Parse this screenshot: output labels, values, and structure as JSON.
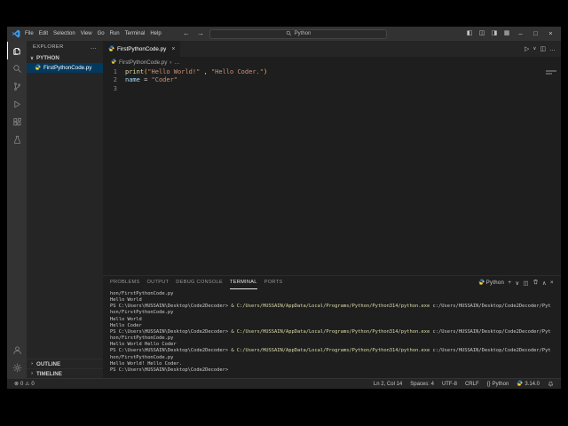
{
  "titlebar": {
    "menus": [
      "File",
      "Edit",
      "Selection",
      "View",
      "Go",
      "Run",
      "Terminal",
      "Help"
    ],
    "search_text": "Python",
    "nav": {
      "back": "←",
      "forward": "→"
    },
    "layout_icons": {
      "toggle_sidebar": "◧",
      "toggle_panel": "◫",
      "toggle_secondary": "◨",
      "customize": "▦"
    },
    "window_icons": {
      "minimize": "–",
      "maximize": "□",
      "close": "×"
    }
  },
  "activitybar": {
    "items": [
      {
        "name": "explorer-icon",
        "active": true
      },
      {
        "name": "search-icon",
        "active": false
      },
      {
        "name": "source-control-icon",
        "active": false
      },
      {
        "name": "run-debug-icon",
        "active": false
      },
      {
        "name": "extensions-icon",
        "active": false
      },
      {
        "name": "testing-icon",
        "active": false
      }
    ],
    "bottom": [
      {
        "name": "account-icon"
      },
      {
        "name": "settings-gear-icon"
      }
    ]
  },
  "sidebar": {
    "title": "EXPLORER",
    "more": "…",
    "folder": {
      "chevron": "∨",
      "label": "PYTHON"
    },
    "file": {
      "label": "FirstPythonCode.py"
    },
    "outline": {
      "chevron": "›",
      "label": "OUTLINE"
    },
    "timeline": {
      "chevron": "›",
      "label": "TIMELINE"
    }
  },
  "editor": {
    "tab": {
      "label": "FirstPythonCode.py",
      "close": "×"
    },
    "tab_actions": {
      "run": "▷",
      "dropdown": "∨",
      "split": "◫",
      "more": "…"
    },
    "breadcrumb": {
      "file": "FirstPythonCode.py",
      "chevron": "›",
      "more": "…"
    },
    "lines": [
      {
        "num": "1",
        "tokens": [
          {
            "t": "print",
            "c": "#dcdcaa"
          },
          {
            "t": "(",
            "c": "#ffd700"
          },
          {
            "t": "\"Hello World!\"",
            "c": "#ce9178"
          },
          {
            "t": " , ",
            "c": "#d4d4d4"
          },
          {
            "t": "\"Hello Coder.\"",
            "c": "#ce9178"
          },
          {
            "t": ")",
            "c": "#ffd700"
          }
        ]
      },
      {
        "num": "2",
        "tokens": [
          {
            "t": "name",
            "c": "#9cdcfe"
          },
          {
            "t": " = ",
            "c": "#d4d4d4"
          },
          {
            "t": "\"Coder\"",
            "c": "#ce9178"
          }
        ]
      },
      {
        "num": "3",
        "tokens": []
      }
    ]
  },
  "panel": {
    "tabs": [
      {
        "label": "PROBLEMS",
        "active": false
      },
      {
        "label": "OUTPUT",
        "active": false
      },
      {
        "label": "DEBUG CONSOLE",
        "active": false
      },
      {
        "label": "TERMINAL",
        "active": true
      },
      {
        "label": "PORTS",
        "active": false
      }
    ],
    "actions": {
      "profile": "Python",
      "plus": "+",
      "dropdown": "∨",
      "split": "◫",
      "chevron_up": "∧",
      "close": "×"
    },
    "terminal_lines": [
      {
        "segs": [
          {
            "t": "hon/FirstPythonCode.py",
            "c": "#cccccc"
          }
        ]
      },
      {
        "segs": [
          {
            "t": "Hello World",
            "c": "#cccccc"
          }
        ]
      },
      {
        "segs": [
          {
            "t": "PS C:\\Users\\HUSSAIN\\Desktop\\Code2Decoder> ",
            "c": "#cccccc"
          },
          {
            "t": "& C:/Users/HUSSAIN/AppData/Local/Programs/Python/Python314/python.exe",
            "c": "#dcdcaa"
          },
          {
            "t": " c:/Users/HUSSAIN/Desktop/Code2Decoder/Pyt",
            "c": "#cccccc"
          }
        ]
      },
      {
        "segs": [
          {
            "t": "hon/FirstPythonCode.py",
            "c": "#cccccc"
          }
        ]
      },
      {
        "segs": [
          {
            "t": "Hello World",
            "c": "#cccccc"
          }
        ]
      },
      {
        "segs": [
          {
            "t": "Hello Coder",
            "c": "#cccccc"
          }
        ]
      },
      {
        "segs": [
          {
            "t": "PS C:\\Users\\HUSSAIN\\Desktop\\Code2Decoder> ",
            "c": "#cccccc"
          },
          {
            "t": "& C:/Users/HUSSAIN/AppData/Local/Programs/Python/Python314/python.exe",
            "c": "#dcdcaa"
          },
          {
            "t": " c:/Users/HUSSAIN/Desktop/Code2Decoder/Pyt",
            "c": "#cccccc"
          }
        ]
      },
      {
        "segs": [
          {
            "t": "hon/FirstPythonCode.py",
            "c": "#cccccc"
          }
        ]
      },
      {
        "segs": [
          {
            "t": "Hello World Hello Coder",
            "c": "#cccccc"
          }
        ]
      },
      {
        "segs": [
          {
            "t": "PS C:\\Users\\HUSSAIN\\Desktop\\Code2Decoder> ",
            "c": "#cccccc"
          },
          {
            "t": "& C:/Users/HUSSAIN/AppData/Local/Programs/Python/Python314/python.exe",
            "c": "#dcdcaa"
          },
          {
            "t": " c:/Users/HUSSAIN/Desktop/Code2Decoder/Pyt",
            "c": "#cccccc"
          }
        ]
      },
      {
        "segs": [
          {
            "t": "hon/FirstPythonCode.py",
            "c": "#cccccc"
          }
        ]
      },
      {
        "segs": [
          {
            "t": "Hello World! Hello Coder.",
            "c": "#cccccc"
          }
        ]
      },
      {
        "segs": [
          {
            "t": "PS C:\\Users\\HUSSAIN\\Desktop\\Code2Decoder>",
            "c": "#cccccc"
          }
        ]
      }
    ]
  },
  "statusbar": {
    "error_icon": "⊗",
    "errors": "0",
    "warning_icon": "⚠",
    "warnings": "0",
    "cursor": "Ln 2, Col 14",
    "indent": "Spaces: 4",
    "encoding": "UTF-8",
    "eol": "CRLF",
    "lang_icon": "{}",
    "language": "Python",
    "python_version": "3.14.0"
  },
  "colors": {
    "accent_blue": "#04395e",
    "terminal_command_yellow": "#dcdcaa",
    "string_orange": "#ce9178",
    "function_yellow": "#dcdcaa",
    "variable_blue": "#9cdcfe"
  }
}
